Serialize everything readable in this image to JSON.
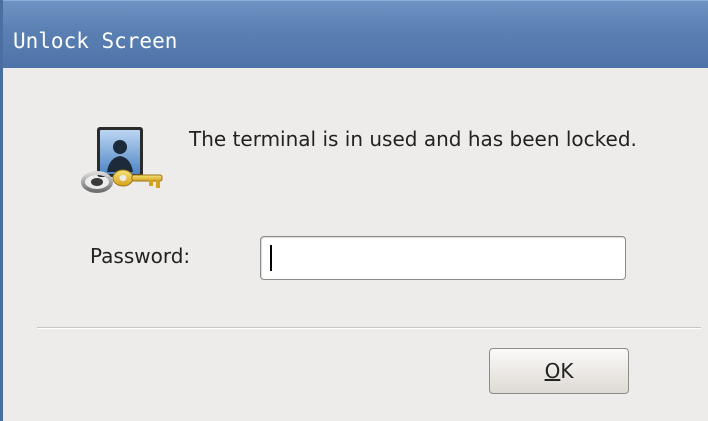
{
  "window": {
    "title": "Unlock Screen",
    "title_color": "#ffffff",
    "titlebar_color": "#5a80b3"
  },
  "content": {
    "icon": "lock-screen-user-key-icon",
    "message": "The terminal is in used and has been locked.",
    "password_label": "Password:",
    "password_value": "",
    "ok_label_mnemonic": "O",
    "ok_label_rest": "K"
  }
}
